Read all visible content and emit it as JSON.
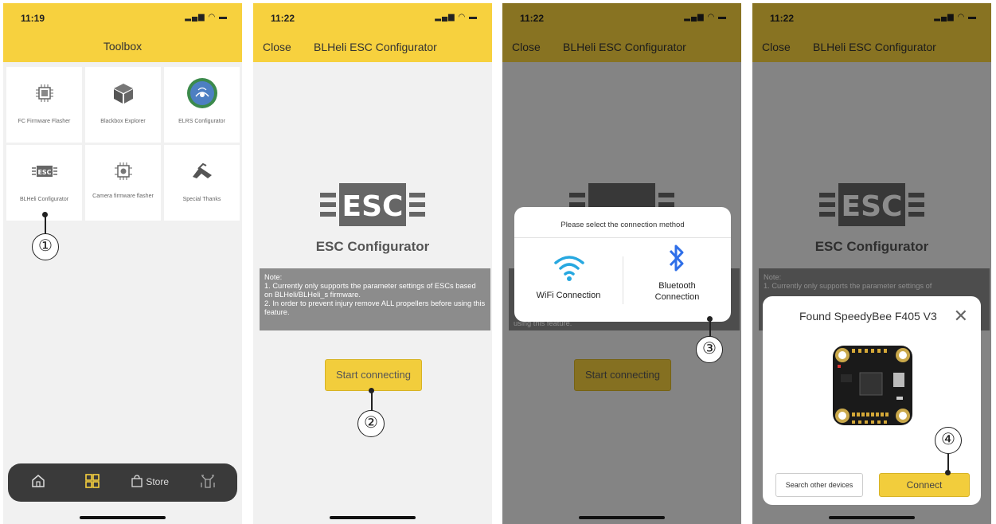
{
  "screens": [
    {
      "status_time": "11:19",
      "header_title": "Toolbox",
      "tiles": [
        {
          "label": "FC Firmware Flasher",
          "icon": "chip-icon"
        },
        {
          "label": "Blackbox Explorer",
          "icon": "cube-icon"
        },
        {
          "label": "ELRS Configurator",
          "icon": "elrs-logo-icon"
        },
        {
          "label": "BLHeli Configurator",
          "icon": "esc-icon"
        },
        {
          "label": "Camera firmware flasher",
          "icon": "camera-chip-icon"
        },
        {
          "label": "Special Thanks",
          "icon": "handshake-icon"
        }
      ],
      "tabbar": {
        "home_icon": "home-icon",
        "grid_icon": "grid-icon",
        "store_label": "Store",
        "profile_icon": "drone-icon"
      },
      "callout": "①"
    },
    {
      "status_time": "11:22",
      "close_label": "Close",
      "header_title": "BLHeli ESC Configurator",
      "logo_text": "ESC",
      "caption": "ESC Configurator",
      "note": [
        "Note:",
        "1. Currently only supports the parameter settings of ESCs based on BLHeli/BLHeli_s firmware.",
        "2. In order to prevent injury remove ALL propellers before using this feature."
      ],
      "start_button": "Start connecting",
      "callout": "②"
    },
    {
      "status_time": "11:22",
      "close_label": "Close",
      "header_title": "BLHeli ESC Configurator",
      "dialog_title": "Please select the connection method",
      "wifi_label": "WiFi Connection",
      "bluetooth_label_1": "Bluetooth",
      "bluetooth_label_2": "Connection",
      "start_button": "Start connecting",
      "note_fragment": "using this feature.",
      "callout": "③"
    },
    {
      "status_time": "11:22",
      "close_label": "Close",
      "header_title": "BLHeli ESC Configurator",
      "logo_text": "ESC",
      "caption": "ESC Configurator",
      "note_fragment_1": "Note:",
      "note_fragment_2": "1. Currently only supports the parameter settings of",
      "found_title": "Found SpeedyBee F405 V3",
      "search_button": "Search other devices",
      "connect_button": "Connect",
      "callout": "④"
    }
  ],
  "colors": {
    "header_yellow": "#f7d13e",
    "button_yellow": "#f2cd3c",
    "note_gray": "#8c8c8c",
    "bluetooth_blue": "#2f6fe8",
    "wifi_blue": "#27a8e0"
  }
}
